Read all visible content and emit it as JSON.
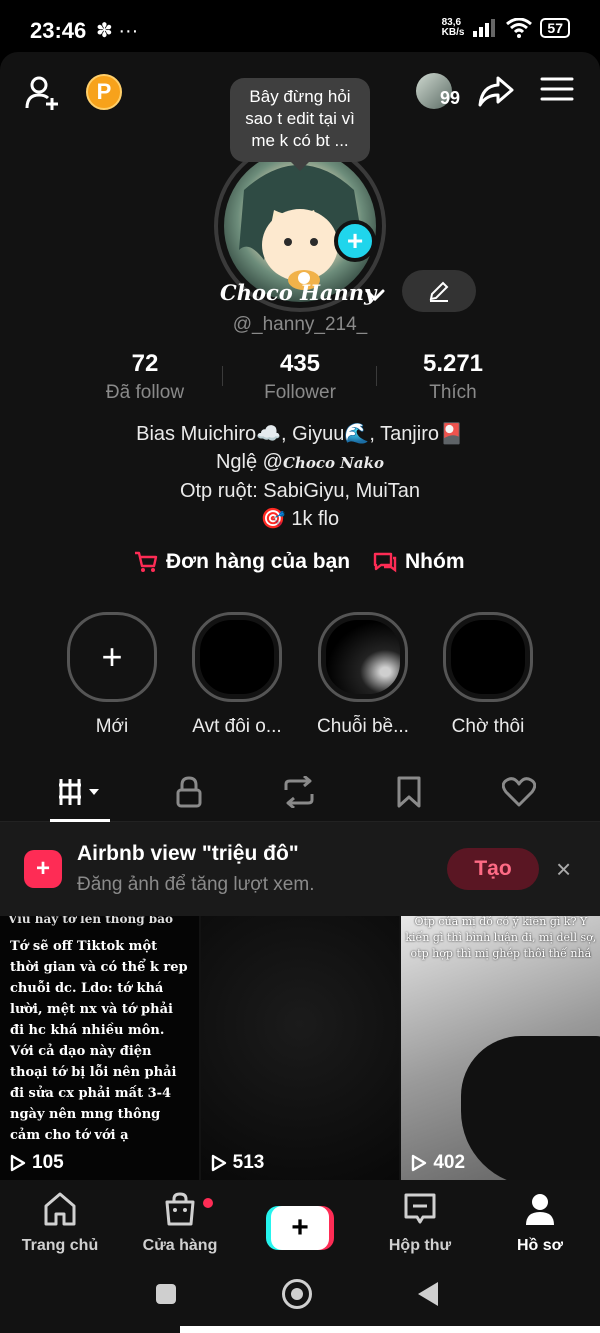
{
  "status_bar": {
    "time": "23:46",
    "left_icons": "✽ ···",
    "net_speed_value": "83,6",
    "net_speed_unit": "KB/s",
    "battery": "57"
  },
  "note_bubble": "Bây đừng hỏi sao t edit tại vì me k có bt ...",
  "coin_label": "P",
  "friends_count": "99",
  "profile": {
    "display_name": "Choco Hanny",
    "username": "@_hanny_214_"
  },
  "stats": [
    {
      "value": "72",
      "label": "Đã follow"
    },
    {
      "value": "435",
      "label": "Follower"
    },
    {
      "value": "5.271",
      "label": "Thích"
    }
  ],
  "bio": {
    "line1": "Bias Muichiro☁️, Giyuu🌊, Tanjiro🎴",
    "line2_prefix": "Nglệ @",
    "line2_mention": "Choco Nako",
    "line3": "Otp ruột: SabiGiyu, MuiTan",
    "line4": "🎯 1k flo"
  },
  "actions": {
    "orders": "Đơn hàng của bạn",
    "group": "Nhóm"
  },
  "highlights": [
    {
      "label": "Mới",
      "icon": "+"
    },
    {
      "label": "Avt đôi o..."
    },
    {
      "label": "Chuỗi bề..."
    },
    {
      "label": "Chờ thôi"
    }
  ],
  "promo": {
    "title": "Airbnb view \"triệu đô\"",
    "subtitle": "Đăng ảnh để tăng lượt xem.",
    "button": "Tạo",
    "close": "×"
  },
  "videos": [
    {
      "views": "105",
      "top_text": "Vìu hãy tớ lên thông báo",
      "text": "Tớ sẽ off Tiktok một thời gian và có thể k rep chuỗi dc. Ldo: tớ khá lười, mệt nx và tớ phải đi hc khá nhiều môn. Với cả dạo này điện thoại tớ bị lỗi nên phải đi sửa cx phải mất 3-4 ngày nên mng thông cảm cho tớ với ạ"
    },
    {
      "views": "513"
    },
    {
      "views": "402",
      "text": "Otp của mị đó có ý kiến gì k? Ý kiến gì thì bình luận đi, mị dell sợ, otp hợp thì mị ghép thôi thế nhá"
    }
  ],
  "bottom_nav": [
    {
      "label": "Trang chủ",
      "icon": "home-icon"
    },
    {
      "label": "Cửa hàng",
      "icon": "shop-icon"
    },
    {
      "label": "+",
      "icon": "create-icon"
    },
    {
      "label": "Hộp thư",
      "icon": "inbox-icon"
    },
    {
      "label": "Hồ sơ",
      "icon": "profile-icon"
    }
  ],
  "colors": {
    "accent_red": "#fe2c55",
    "accent_cyan": "#20d5ec",
    "coin": "#f7a21b",
    "background": "#121212"
  }
}
